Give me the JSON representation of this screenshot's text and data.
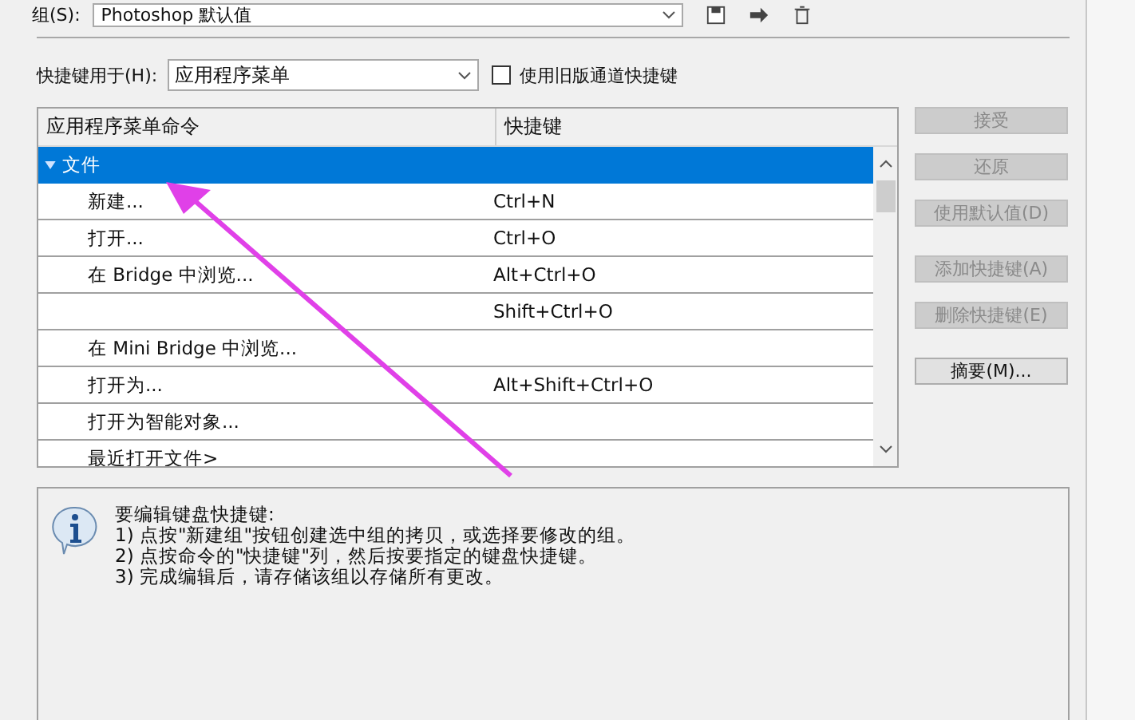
{
  "set_row": {
    "label": "组(S):",
    "value": "Photoshop 默认值"
  },
  "shortcuts_for": {
    "label": "快捷键用于(H):",
    "value": "应用程序菜单",
    "legacy_checkbox": {
      "label": "使用旧版通道快捷键",
      "checked": false
    }
  },
  "table": {
    "columns": [
      "应用程序菜单命令",
      "快捷键"
    ],
    "rows": [
      {
        "kind": "group",
        "command": "文件",
        "shortcut": "",
        "expanded": true,
        "selected": true
      },
      {
        "kind": "item",
        "command": "新建...",
        "shortcut": "Ctrl+N",
        "selected": false
      },
      {
        "kind": "item",
        "command": "打开...",
        "shortcut": "Ctrl+O",
        "selected": false
      },
      {
        "kind": "item",
        "command": "在 Bridge 中浏览...",
        "shortcut": "Alt+Ctrl+O",
        "selected": false
      },
      {
        "kind": "item",
        "command": "",
        "shortcut": "Shift+Ctrl+O",
        "selected": false
      },
      {
        "kind": "item",
        "command": "在 Mini Bridge 中浏览...",
        "shortcut": "",
        "selected": false
      },
      {
        "kind": "item",
        "command": "打开为...",
        "shortcut": "Alt+Shift+Ctrl+O",
        "selected": false
      },
      {
        "kind": "item",
        "command": "打开为智能对象...",
        "shortcut": "",
        "selected": false
      },
      {
        "kind": "item",
        "command": "最近打开文件>",
        "shortcut": "",
        "selected": false
      }
    ]
  },
  "buttons": [
    {
      "label": "接受",
      "disabled": true
    },
    {
      "label": "还原",
      "disabled": true
    },
    {
      "label": "使用默认值(D)",
      "disabled": true
    },
    {
      "label": "添加快捷键(A)",
      "disabled": true
    },
    {
      "label": "删除快捷键(E)",
      "disabled": true
    },
    {
      "label": "摘要(M)...",
      "disabled": false
    }
  ],
  "info": {
    "lines": [
      "要编辑键盘快捷键:",
      "1) 点按\"新建组\"按钮创建选中组的拷贝，或选择要修改的组。",
      "2) 点按命令的\"快捷键\"列，然后按要指定的键盘快捷键。",
      "3) 完成编辑后，请存储该组以存储所有更改。"
    ]
  }
}
